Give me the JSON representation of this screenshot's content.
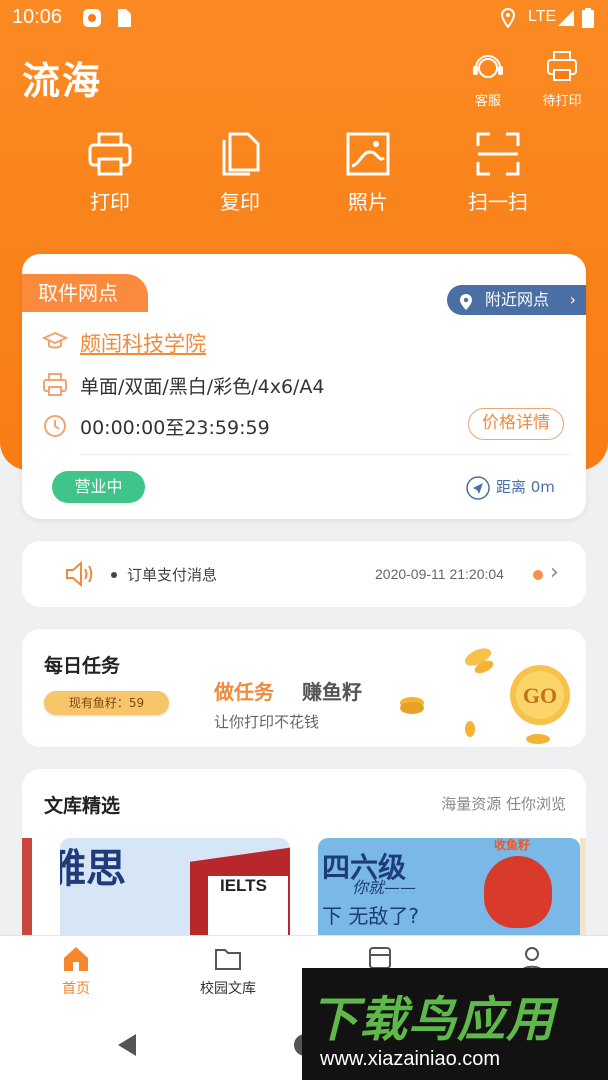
{
  "status_bar": {
    "time": "10:06",
    "network": "LTE"
  },
  "header": {
    "app_title": "流海",
    "actions": [
      {
        "label": "客服",
        "icon": "headset-icon"
      },
      {
        "label": "待打印",
        "icon": "printer-icon"
      }
    ],
    "quick_actions": [
      {
        "label": "打印",
        "icon": "printer-icon"
      },
      {
        "label": "复印",
        "icon": "copy-icon"
      },
      {
        "label": "照片",
        "icon": "photo-icon"
      },
      {
        "label": "扫一扫",
        "icon": "scan-icon"
      }
    ]
  },
  "pickup": {
    "tag": "取件网点",
    "nearby_label": "附近网点",
    "school": "颇闰科技学院",
    "services": "单面/双面/黑白/彩色/4x6/A4",
    "hours": "00:00:00至23:59:59",
    "price_details": "价格详情",
    "status": "营业中",
    "distance": "距离 0m",
    "accent_color": "#f08b3e",
    "status_color": "#3fc48a"
  },
  "notice": {
    "message": "订单支付消息",
    "time": "2020-09-11 21:20:04"
  },
  "daily_task": {
    "title": "每日任务",
    "balance": "现有鱼籽：59",
    "do_task": "做任务",
    "earn": "赚鱼籽",
    "subtitle": "让你打印不花钱",
    "badge": "GO"
  },
  "library": {
    "title": "文库精选",
    "slogan": "海量资源 任你浏览",
    "books": [
      {
        "heading": "雅思",
        "badge": "IELTS"
      },
      {
        "heading": "四六级",
        "line1": "你就——",
        "line2": "下 无敌了?",
        "badge": "收鱼籽"
      }
    ]
  },
  "tabbar": {
    "items": [
      {
        "label": "首页",
        "icon": "home-icon",
        "active": true
      },
      {
        "label": "校园文库",
        "icon": "folder-icon",
        "active": false
      },
      {
        "label": "",
        "icon": "shop-icon",
        "active": false
      },
      {
        "label": "",
        "icon": "person-icon",
        "active": false
      }
    ]
  },
  "watermark": {
    "title": "下载鸟应用",
    "url": "www.xiazainiao.com"
  },
  "brand_color": "#f97c14"
}
